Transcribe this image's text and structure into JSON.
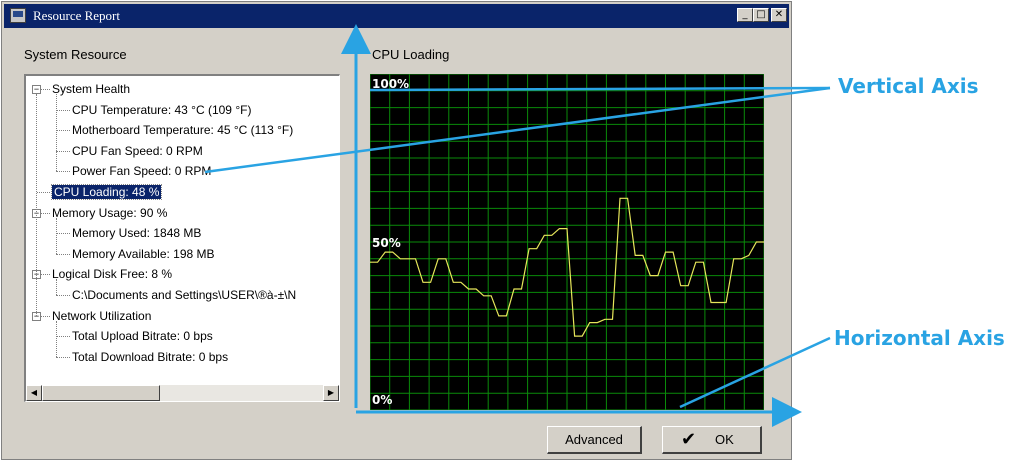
{
  "window": {
    "title": "Resource Report",
    "controls": {
      "minimize": "_",
      "maximize": "□",
      "close": "✕"
    },
    "icon": "app-window-icon"
  },
  "system_panel": {
    "label": "System Resource",
    "tree": [
      {
        "label": "System Health",
        "level": 0,
        "expander": "−"
      },
      {
        "label": "CPU Temperature: 43 °C (109 °F)",
        "level": 1
      },
      {
        "label": "Motherboard Temperature: 45 °C (113 °F)",
        "level": 1
      },
      {
        "label": "CPU Fan Speed: 0 RPM",
        "level": 1
      },
      {
        "label": "Power Fan Speed: 0 RPM",
        "level": 1
      },
      {
        "label": "CPU Loading: 48 %",
        "level": 0,
        "selected": true
      },
      {
        "label": "Memory Usage: 90 %",
        "level": 0,
        "expander": "−"
      },
      {
        "label": "Memory Used: 1848 MB",
        "level": 1
      },
      {
        "label": "Memory Available: 198 MB",
        "level": 1
      },
      {
        "label": "Logical Disk Free: 8 %",
        "level": 0,
        "expander": "−"
      },
      {
        "label": "C:\\Documents and Settings\\USER\\®à-±\\N",
        "level": 1
      },
      {
        "label": "Network Utilization",
        "level": 0,
        "expander": "−"
      },
      {
        "label": "Total Upload Bitrate: 0 bps",
        "level": 1
      },
      {
        "label": "Total Download Bitrate: 0 bps",
        "level": 1
      }
    ],
    "scroll": {
      "left": "◀",
      "right": "▶",
      "thumb_fraction": 0.42
    }
  },
  "cpu_panel": {
    "label": "CPU Loading"
  },
  "chart_data": {
    "type": "line",
    "title": "CPU Loading",
    "ylim": [
      0,
      100
    ],
    "y_tick_labels": [
      "100%",
      "50%",
      "0%"
    ],
    "grid": true,
    "background": "#000000",
    "grid_color": "#0a8a0a",
    "line_color": "#e6e65a",
    "label_color": "#ffffff",
    "series": [
      {
        "values": [
          44,
          44,
          47,
          47,
          45,
          45,
          45,
          38,
          38,
          45,
          45,
          38,
          38,
          36,
          36,
          34,
          34,
          28,
          28,
          36,
          36,
          48,
          48,
          52,
          52,
          54,
          54,
          22,
          22,
          26,
          26,
          27,
          27,
          63,
          63,
          46,
          46,
          40,
          40,
          47,
          47,
          37,
          37,
          44,
          44,
          32,
          32,
          32,
          45,
          45,
          46,
          50,
          50
        ]
      }
    ]
  },
  "buttons": {
    "advanced": "Advanced",
    "ok": "OK",
    "ok_icon": "checkmark-icon"
  },
  "annotations": {
    "vertical": "Vertical Axis",
    "horizontal": "Horizontal Axis",
    "arrow_color": "#29a3e3"
  }
}
